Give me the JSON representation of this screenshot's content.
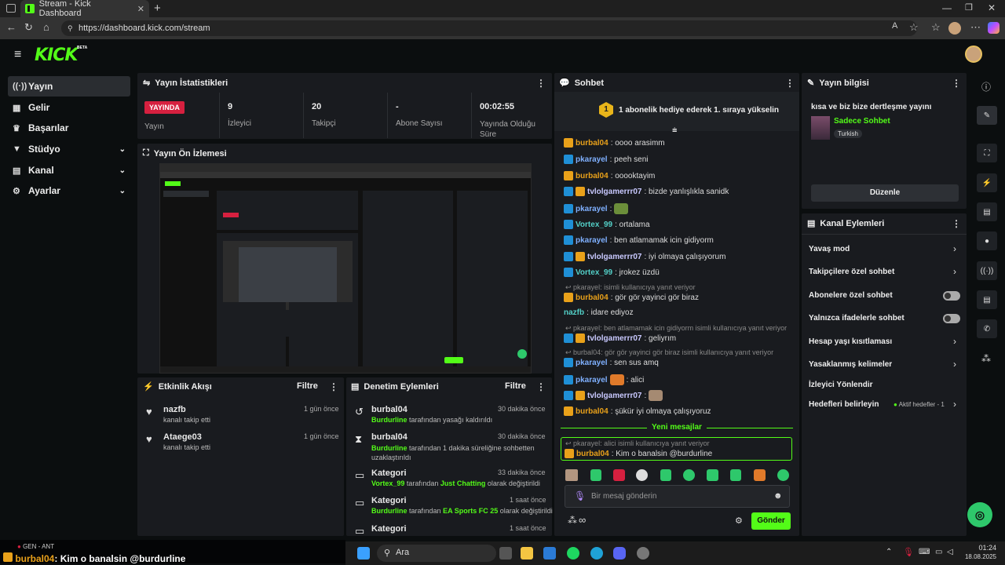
{
  "browser": {
    "tab_title": "Stream - Kick Dashboard",
    "url": "https://dashboard.kick.com/stream"
  },
  "header": {
    "logo": "KICK",
    "beta": "BETA"
  },
  "sidebar": {
    "items": [
      {
        "label": "Yayın",
        "icon": "broadcast-icon"
      },
      {
        "label": "Gelir",
        "icon": "revenue-icon"
      },
      {
        "label": "Başarılar",
        "icon": "trophy-icon"
      },
      {
        "label": "Stüdyo",
        "icon": "studio-icon"
      },
      {
        "label": "Kanal",
        "icon": "channel-icon"
      },
      {
        "label": "Ayarlar",
        "icon": "gear-icon"
      }
    ]
  },
  "stats": {
    "title": "Yayın İstatistikleri",
    "live_badge": "YAYINDA",
    "live_label": "Yayın",
    "viewers": "9",
    "viewers_label": "İzleyici",
    "followers": "20",
    "followers_label": "Takipçi",
    "subs": "-",
    "subs_label": "Abone Sayısı",
    "uptime": "00:02:55",
    "uptime_label": "Yayında Olduğu Süre"
  },
  "preview": {
    "title": "Yayın Ön İzlemesi"
  },
  "activity": {
    "title": "Etkinlik Akışı",
    "filter": "Filtre",
    "items": [
      {
        "name": "nazfb",
        "desc": "kanalı takip etti",
        "time": "1 gün önce"
      },
      {
        "name": "Ataege03",
        "desc": "kanalı takip etti",
        "time": "1 gün önce"
      }
    ]
  },
  "moderation": {
    "title": "Denetim Eylemleri",
    "filter": "Filtre",
    "items": [
      {
        "name": "burbal04",
        "actor": "Burdurline",
        "desc": " tarafından yasağı kaldırıldı",
        "time": "30 dakika önce"
      },
      {
        "name": "burbal04",
        "actor": "Burdurline",
        "desc": " tarafından 1 dakika süreliğine sohbetten uzaklaştırıldı",
        "time": "30 dakika önce"
      },
      {
        "name": "Kategori",
        "actor": "Vortex_99",
        "desc": " tarafından ",
        "extra": "Just Chatting",
        "desc2": " olarak değiştirildi",
        "time": "33 dakika önce"
      },
      {
        "name": "Kategori",
        "actor": "Burdurline",
        "desc": " tarafından ",
        "extra": "EA Sports FC 25",
        "desc2": " olarak değiştirildi",
        "time": "1 saat önce"
      },
      {
        "name": "Kategori",
        "time": "1 saat önce"
      }
    ]
  },
  "chat": {
    "title": "Sohbet",
    "gift_text": "1 abonelik hediye ederek 1. sıraya yükselin",
    "gift_rank": "1",
    "messages": [
      {
        "user": "burbal04",
        "text": ": oooo arasimm",
        "color": "#e9a11a"
      },
      {
        "user": "pkarayel",
        "text": ": peeh seni",
        "color": "#7fb0ff"
      },
      {
        "user": "burbal04",
        "text": ": ooooktayim",
        "color": "#e9a11a"
      },
      {
        "user": "tvlolgamerrr07",
        "text": ": bizde yanlışlıkla sanidk",
        "color": "#c9c9ff"
      },
      {
        "user": "pkarayel",
        "text": ":",
        "color": "#7fb0ff"
      },
      {
        "user": "Vortex_99",
        "text": ": ortalama",
        "color": "#53d0c8"
      },
      {
        "user": "pkarayel",
        "text": ": ben atlamamak icin gidiyorm",
        "color": "#7fb0ff"
      },
      {
        "user": "tvlolgamerrr07",
        "text": ": iyi olmaya çalışıyorum",
        "color": "#c9c9ff"
      },
      {
        "user": "Vortex_99",
        "text": ": jrokez üzdü",
        "color": "#53d0c8"
      },
      {
        "user": "burbal04",
        "text": ": gör gör yayinci gör biraz",
        "color": "#e9a11a"
      },
      {
        "user": "nazfb",
        "text": ": idare ediyoz",
        "color": "#53d0c8"
      },
      {
        "user": "tvlolgamerrr07",
        "text": ": geliyrım",
        "color": "#c9c9ff"
      },
      {
        "user": "pkarayel",
        "text": ": sen sus amq",
        "color": "#7fb0ff"
      },
      {
        "user": "pkarayel",
        "text": ": alici",
        "color": "#7fb0ff"
      },
      {
        "user": "tvlolgamerrr07",
        "text": ":",
        "color": "#c9c9ff"
      },
      {
        "user": "burbal04",
        "text": ": şükür iyi olmaya çalışıyoruz",
        "color": "#e9a11a"
      }
    ],
    "replies": [
      "pkarayel: isimli kullanıcıya yanıt veriyor",
      "pkarayel: ben atlamamak icin gidiyorm isimli kullanıcıya yanıt veriyor",
      "burbal04: gör gör yayinci gör biraz isimli kullanıcıya yanıt veriyor"
    ],
    "new_messages": "Yeni mesajlar",
    "highlight_reply": "pkarayel: alici isimli kullanıcıya yanıt veriyor",
    "highlight_user": "burbal04",
    "highlight_text": ": Kim o banalsin @burdurline",
    "input_placeholder": "Bir mesaj gönderin",
    "send": "Gönder",
    "infinity": "∞"
  },
  "streaminfo": {
    "title": "Yayın bilgisi",
    "stream_title": "kısa ve biz bize dertleşme yayını",
    "category": "Sadece Sohbet",
    "tag": "Turkish",
    "edit": "Düzenle"
  },
  "channel_actions": {
    "title": "Kanal Eylemleri",
    "items": [
      {
        "label": "Yavaş mod"
      },
      {
        "label": "Takipçilere özel sohbet"
      },
      {
        "label": "Abonelere özel sohbet"
      },
      {
        "label": "Yalnızca ifadelerle sohbet"
      },
      {
        "label": "Hesap yaşı kısıtlaması"
      },
      {
        "label": "Yasaklanmış kelimeler"
      },
      {
        "label": "İzleyici Yönlendir"
      },
      {
        "label": "Hedefleri belirleyin"
      }
    ],
    "goals_status": "Aktif hedefler - 1"
  },
  "overlay_chat": {
    "user": "burbal04",
    "text": ": Kim o banalsin @burdurline",
    "game": "GEN - ANT"
  },
  "taskbar": {
    "search": "Ara",
    "time": "01:24",
    "date": "18.08.2025"
  }
}
